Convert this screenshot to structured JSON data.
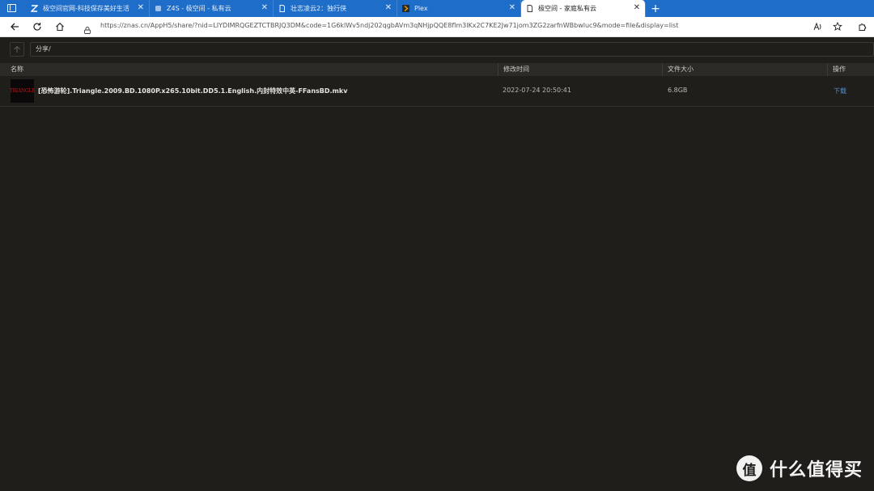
{
  "tabs": [
    {
      "title": "极空间官网-科技保存美好生活",
      "icon": "znas-icon",
      "active": false
    },
    {
      "title": "Z4S - 极空间 - 私有云",
      "icon": "page-icon",
      "active": false
    },
    {
      "title": "壮志凌云2：独行侠",
      "icon": "document-icon",
      "active": false
    },
    {
      "title": "Plex",
      "icon": "plex-icon",
      "active": false
    },
    {
      "title": "极空间 - 家庭私有云",
      "icon": "document-icon",
      "active": true
    }
  ],
  "nav": {
    "url": "https://znas.cn/AppH5/share/?nid=LIYDIMRQGEZTCTBRJQ3DM&code=1G6klWv5ndj202qgbAVm3qNHjpQQE8flm3lKx2C7KE2Jw71jom3ZG2zarfnWBbwluc9&mode=file&display=list"
  },
  "path": {
    "value": "分享/"
  },
  "table": {
    "headers": {
      "name": "名称",
      "modified": "修改时间",
      "size": "文件大小",
      "action": "操作"
    },
    "rows": [
      {
        "thumb_text": "TRIANGLE",
        "name": "[恐怖游轮].Triangle.2009.BD.1080P.x265.10bit.DD5.1.English.内封特效中英-FFansBD.mkv",
        "modified": "2022-07-24 20:50:41",
        "size": "6.8GB",
        "action": "下载"
      }
    ]
  },
  "watermark": {
    "badge": "值",
    "text": "什么值得买"
  },
  "colors": {
    "tabstrip": "#1e6ec9",
    "background": "#1f1e1b",
    "link": "#4f8ed1"
  }
}
